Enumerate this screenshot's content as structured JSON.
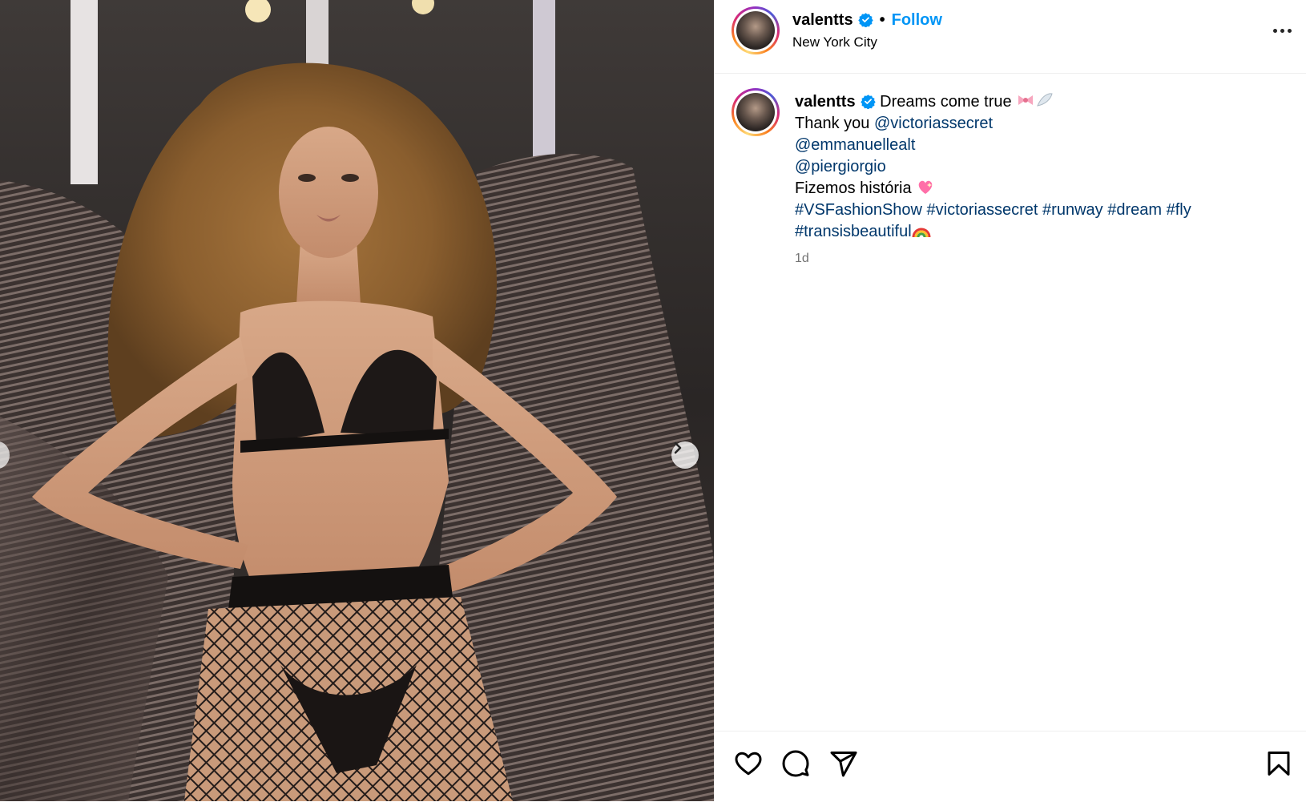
{
  "header": {
    "username": "valentts",
    "separator": "•",
    "follow_label": "Follow",
    "location": "New York City"
  },
  "caption": {
    "username": "valentts",
    "line1_text": "Dreams come true",
    "thank_prefix": "Thank you",
    "mentions": [
      "@victoriassecret",
      "@emmanuellealt",
      "@piergiorgio"
    ],
    "line_fizemos": "Fizemos história",
    "hashtags": [
      "#VSFashionShow",
      "#victoriassecret",
      "#runway",
      "#dream",
      "#fly",
      "#transisbeautiful"
    ],
    "timestamp": "1d"
  },
  "colors": {
    "accent_blue": "#0095f6",
    "link_blue": "#00376b",
    "verified_blue": "#0095f6",
    "muted_text": "#737373"
  },
  "icons": [
    "verified-badge-icon",
    "more-options-icon",
    "chevron-right-icon",
    "heart-icon",
    "comment-icon",
    "share-icon",
    "bookmark-icon"
  ]
}
